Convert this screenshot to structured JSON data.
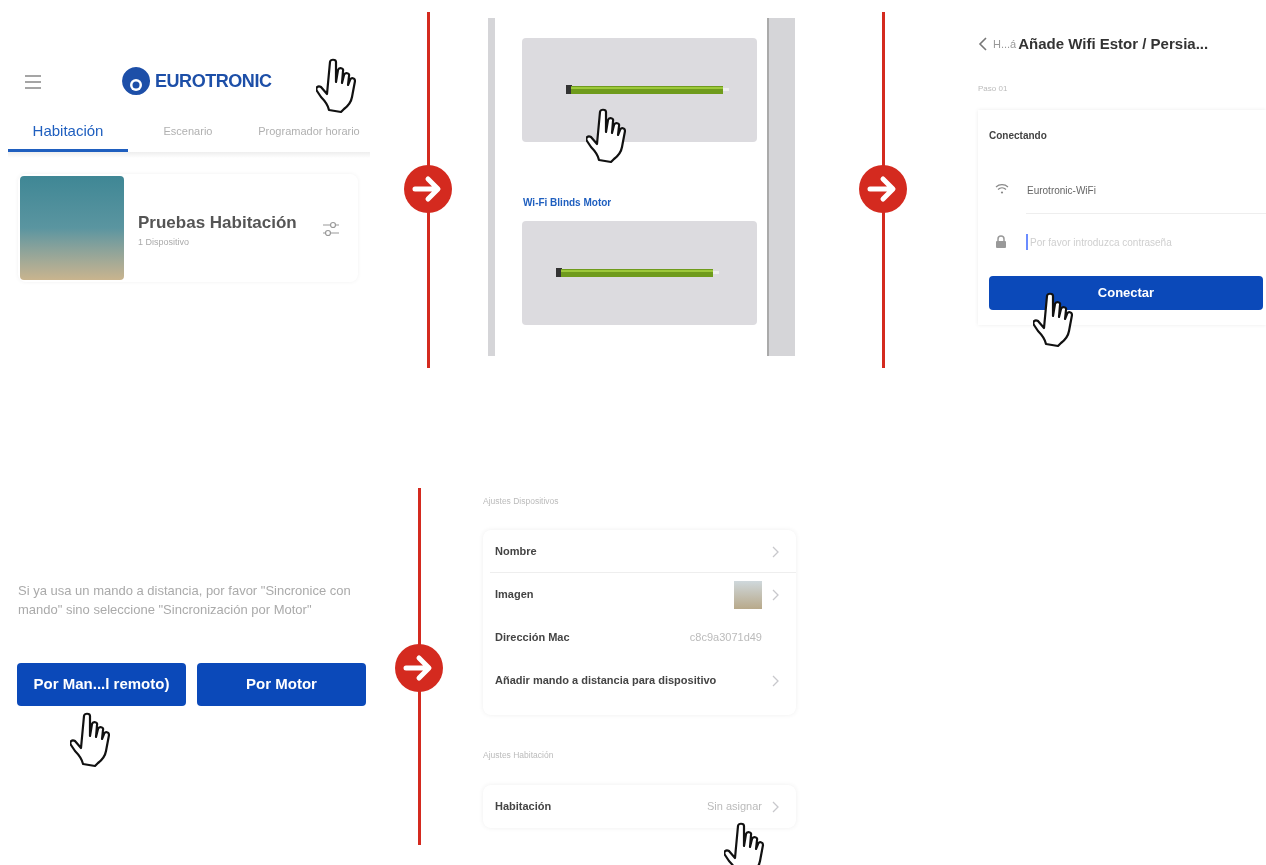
{
  "home_screen": {
    "logo": "EUROTRONIC",
    "tabs": [
      {
        "label": "Habitación",
        "selected": true
      },
      {
        "label": "Escenario",
        "selected": false
      },
      {
        "label": "Programador horario",
        "selected": false
      }
    ],
    "room": {
      "name": "Pruebas Habitación",
      "devices": "1 Dispositivo"
    }
  },
  "motor_list": {
    "sections": [
      {
        "kind": "card"
      },
      {
        "kind": "titled_card",
        "title": "Wi-Fi Blinds Motor"
      }
    ]
  },
  "wifi_setup": {
    "back": "H...á",
    "title": "Añade Wifi Estor / Persia...",
    "step": "Paso 01",
    "card_title": "Conectando",
    "network": "Eurotronic-WiFi",
    "password": {
      "placeholder": "Por favor introduzca contraseña"
    },
    "button": "Conectar"
  },
  "sync_dialog": {
    "message": "Si ya usa un mando a distancia, por favor \"Sincronice con mando\" sino seleccione \"Sincronización por Motor\"",
    "buttons": [
      "Por Man...l remoto)",
      "Por Motor"
    ]
  },
  "device_settings": {
    "device_header": "Ajustes Dispositivos",
    "device_rows": [
      {
        "kind": "link",
        "label": "Nombre"
      },
      {
        "kind": "image",
        "label": "Imagen"
      },
      {
        "kind": "value",
        "label": "Dirección Mac",
        "value": "c8c9a3071d49"
      },
      {
        "kind": "link",
        "label": "Añadir mando a distancia para dispositivo"
      }
    ],
    "room_header": "Ajustes Habitación",
    "room_rows": [
      {
        "kind": "value_link",
        "label": "Habitación",
        "value": "Sin asignar"
      }
    ]
  }
}
